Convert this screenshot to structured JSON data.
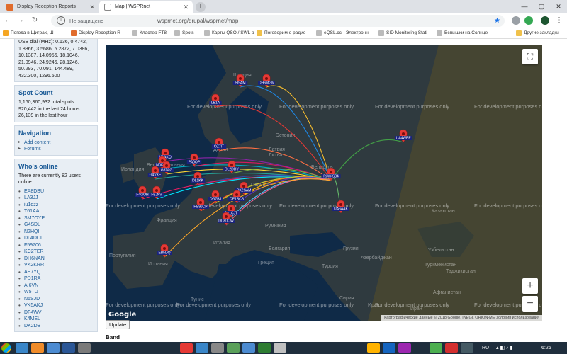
{
  "browser": {
    "tabs": [
      {
        "title": "Display Reception Reports",
        "active": false
      },
      {
        "title": "Map | WSPRnet",
        "active": true
      }
    ],
    "address": {
      "security": "Не защищено",
      "url": "wsprnet.org/drupal/wsprnet/map"
    },
    "bookmarks": [
      "Погода в Щиграх, Ш",
      "Display Reception R",
      "Кластер FT8",
      "Spots",
      "Карты QSO / SWL р",
      "Поговорим о радио",
      "eQSL.cc - Электронн",
      "SID Monitoring Stati",
      "Вспышки на Солнце",
      "Другие закладки"
    ]
  },
  "sidebar": {
    "frequencies_text": "USB dial (MHz): 0.136, 0.4742, 1.8366, 3.5686, 5.2872, 7.0386, 10.1387, 14.0956, 18.1046, 21.0946, 24.9246, 28.1246, 50.293, 70.091, 144.489, 432.300, 1296.500",
    "spot_count": {
      "title": "Spot Count",
      "total": "1,160,360,932 total spots",
      "last24": "920,442 in the last 24 hours",
      "lasthour": "26,139 in the last hour"
    },
    "navigation": {
      "title": "Navigation",
      "items": [
        "Add content",
        "Forums"
      ]
    },
    "whos_online": {
      "title": "Who's online",
      "summary": "There are currently 82 users online.",
      "users": [
        "EA8DBU",
        "LA3JJ",
        "iu1dzz",
        "T61AA",
        "SM7OYP",
        "G4SDL",
        "N2HQI",
        "DL4DCL",
        "F59706",
        "KC2TER",
        "DH6NAN",
        "VK2KRR",
        "AE7YQ",
        "PD1RA",
        "AI6VN",
        "W5TU",
        "N6SJD",
        "VK5AKJ",
        "DF4WV",
        "K4MEL",
        "DK2DB"
      ]
    }
  },
  "map": {
    "center_station": "R3W-S84",
    "watermark": "For development purposes only",
    "attribution": "Картографические данные © 2018 Google, INEGI, ORION-ME   Условия использования",
    "google_logo": "Google",
    "labels": [
      {
        "text": "Швеция"
      },
      {
        "text": "Эстония"
      },
      {
        "text": "Латвия"
      },
      {
        "text": "Литва"
      },
      {
        "text": "Дания"
      },
      {
        "text": "Ирландия"
      },
      {
        "text": "Великобритания"
      },
      {
        "text": "Беларусь"
      },
      {
        "text": "Франция"
      },
      {
        "text": "Польша"
      },
      {
        "text": "Румыния"
      },
      {
        "text": "Италия"
      },
      {
        "text": "Болгария"
      },
      {
        "text": "Греция"
      },
      {
        "text": "Турция"
      },
      {
        "text": "Грузия"
      },
      {
        "text": "Азербайджан"
      },
      {
        "text": "Португалия"
      },
      {
        "text": "Испания"
      },
      {
        "text": "Казахстан"
      },
      {
        "text": "Узбекистан"
      },
      {
        "text": "Туркменистан"
      },
      {
        "text": "Таджикистан"
      },
      {
        "text": "Афганистан"
      },
      {
        "text": "Сирия"
      },
      {
        "text": "Ирак"
      },
      {
        "text": "Иран"
      },
      {
        "text": "Тунис"
      }
    ],
    "stations": [
      {
        "call": "SI9AM"
      },
      {
        "call": "OH6MGM"
      },
      {
        "call": "LB1A"
      },
      {
        "call": "UA4WPF"
      },
      {
        "call": "OZ7IT"
      },
      {
        "call": "M1AKQ"
      },
      {
        "call": "M0KMX"
      },
      {
        "call": "G3TAG"
      },
      {
        "call": "G4VXE"
      },
      {
        "call": "PA0OP"
      },
      {
        "call": "DL2DDY"
      },
      {
        "call": "DL1KK"
      },
      {
        "call": "OK2SAM"
      },
      {
        "call": "F4GOH"
      },
      {
        "call": "F5JNV"
      },
      {
        "call": "HB9JCP"
      },
      {
        "call": "DG7BJ"
      },
      {
        "call": "OE1SCS"
      },
      {
        "call": "9A1CJT"
      },
      {
        "call": "DL3DOW"
      },
      {
        "call": "UA6AAK"
      },
      {
        "call": "EB5DQ"
      }
    ],
    "update_button": "Update",
    "band_label": "Band"
  },
  "taskbar": {
    "lang": "RU",
    "time": "6:26"
  },
  "colors": {
    "map_bg": "#0f2a47",
    "land": "#2f3a3f",
    "night": "rgba(88,78,40,0.55)",
    "pin": "#e53935",
    "sidebar_bg": "#e8eef4",
    "link": "#1a5a96"
  }
}
